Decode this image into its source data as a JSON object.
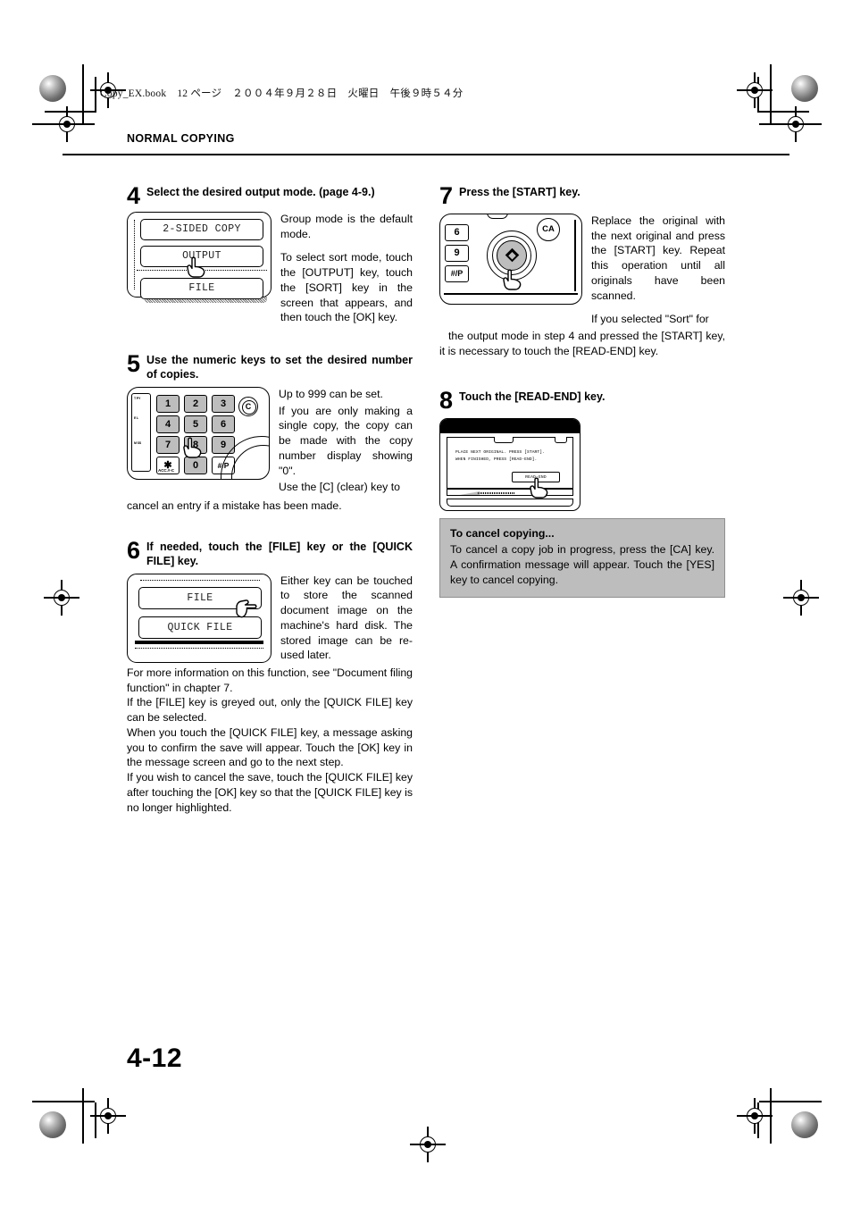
{
  "print_stamp": {
    "filename": "Copy_EX.book",
    "page_label": "12 ページ",
    "date": "２００４年９月２８日",
    "weekday": "火曜日",
    "time": "午後９時５４分"
  },
  "running_head": "NORMAL COPYING",
  "folio": "4-12",
  "steps": [
    {
      "number": "4",
      "title": "Select the desired output mode. (page 4-9.)",
      "figure": {
        "type": "touch-panel",
        "keys": [
          "2-SIDED COPY",
          "OUTPUT",
          "FILE"
        ]
      },
      "paragraphs": [
        "Group mode is the default mode.",
        "To select sort mode, touch the [OUTPUT] key, touch the [SORT] key in the screen that appears, and then touch the [OK] key."
      ]
    },
    {
      "number": "5",
      "title": "Use the numeric keys to set the desired number of copies.",
      "figure": {
        "type": "numeric-keypad",
        "keys": [
          "1",
          "2",
          "3",
          "4",
          "5",
          "6",
          "7",
          "8",
          "9",
          "✱",
          "0",
          "#/P"
        ],
        "clear_key": "C",
        "acc_label": "ACC.#-C",
        "side_labels": [
          "T PY",
          "E L",
          "M SS"
        ]
      },
      "paragraphs": [
        "Up to 999 can be set.",
        "If you are only making a single copy, the copy can be made with the copy number display showing \"0\".",
        "Use the [C] (clear) key to"
      ],
      "wide_text": "cancel an entry if a mistake has been made."
    },
    {
      "number": "6",
      "title": "If needed, touch the [FILE] key or the [QUICK FILE] key.",
      "figure": {
        "type": "touch-panel",
        "keys": [
          "FILE",
          "QUICK FILE"
        ]
      },
      "paragraphs": [
        "Either key can be touched to store the scanned document image on the machine's hard disk. The stored image can be re-used later."
      ],
      "wide_paragraphs": [
        "For more information on this function, see \"Document filing function\" in chapter 7.",
        "If the [FILE] key is greyed out, only the [QUICK FILE] key can be selected.",
        "When you touch the [QUICK FILE] key, a message asking you to confirm the save will appear. Touch the [OK] key in the message screen and go to the next step.",
        "If you wish to cancel the save, touch the [QUICK FILE] key after touching the [OK] key so that the [QUICK FILE] key is no longer highlighted."
      ]
    },
    {
      "number": "7",
      "title": "Press the [START] key.",
      "figure": {
        "type": "start-key-panel",
        "keys": [
          "6",
          "9",
          "#/P"
        ],
        "ca_key": "CA"
      },
      "paragraphs": [
        "Replace the original with the next original and press the [START] key. Repeat this operation until all originals have been scanned.",
        "If you selected \"Sort\" for"
      ],
      "wide_text": "the output mode in step 4 and pressed the [START] key, it is necessary to touch the [READ-END] key."
    },
    {
      "number": "8",
      "title": "Touch the [READ-END] key.",
      "figure": {
        "type": "lcd-screen",
        "message_line1": "PLACE NEXT ORIGINAL. PRESS [START].",
        "message_line2": "WHEN FINISHED, PRESS [READ-END].",
        "button": "READ-END"
      }
    }
  ],
  "note_box": {
    "title": "To cancel copying...",
    "body": "To cancel a copy job in progress, press the [CA] key. A confirmation message will appear. Touch the [YES] key to cancel copying."
  }
}
